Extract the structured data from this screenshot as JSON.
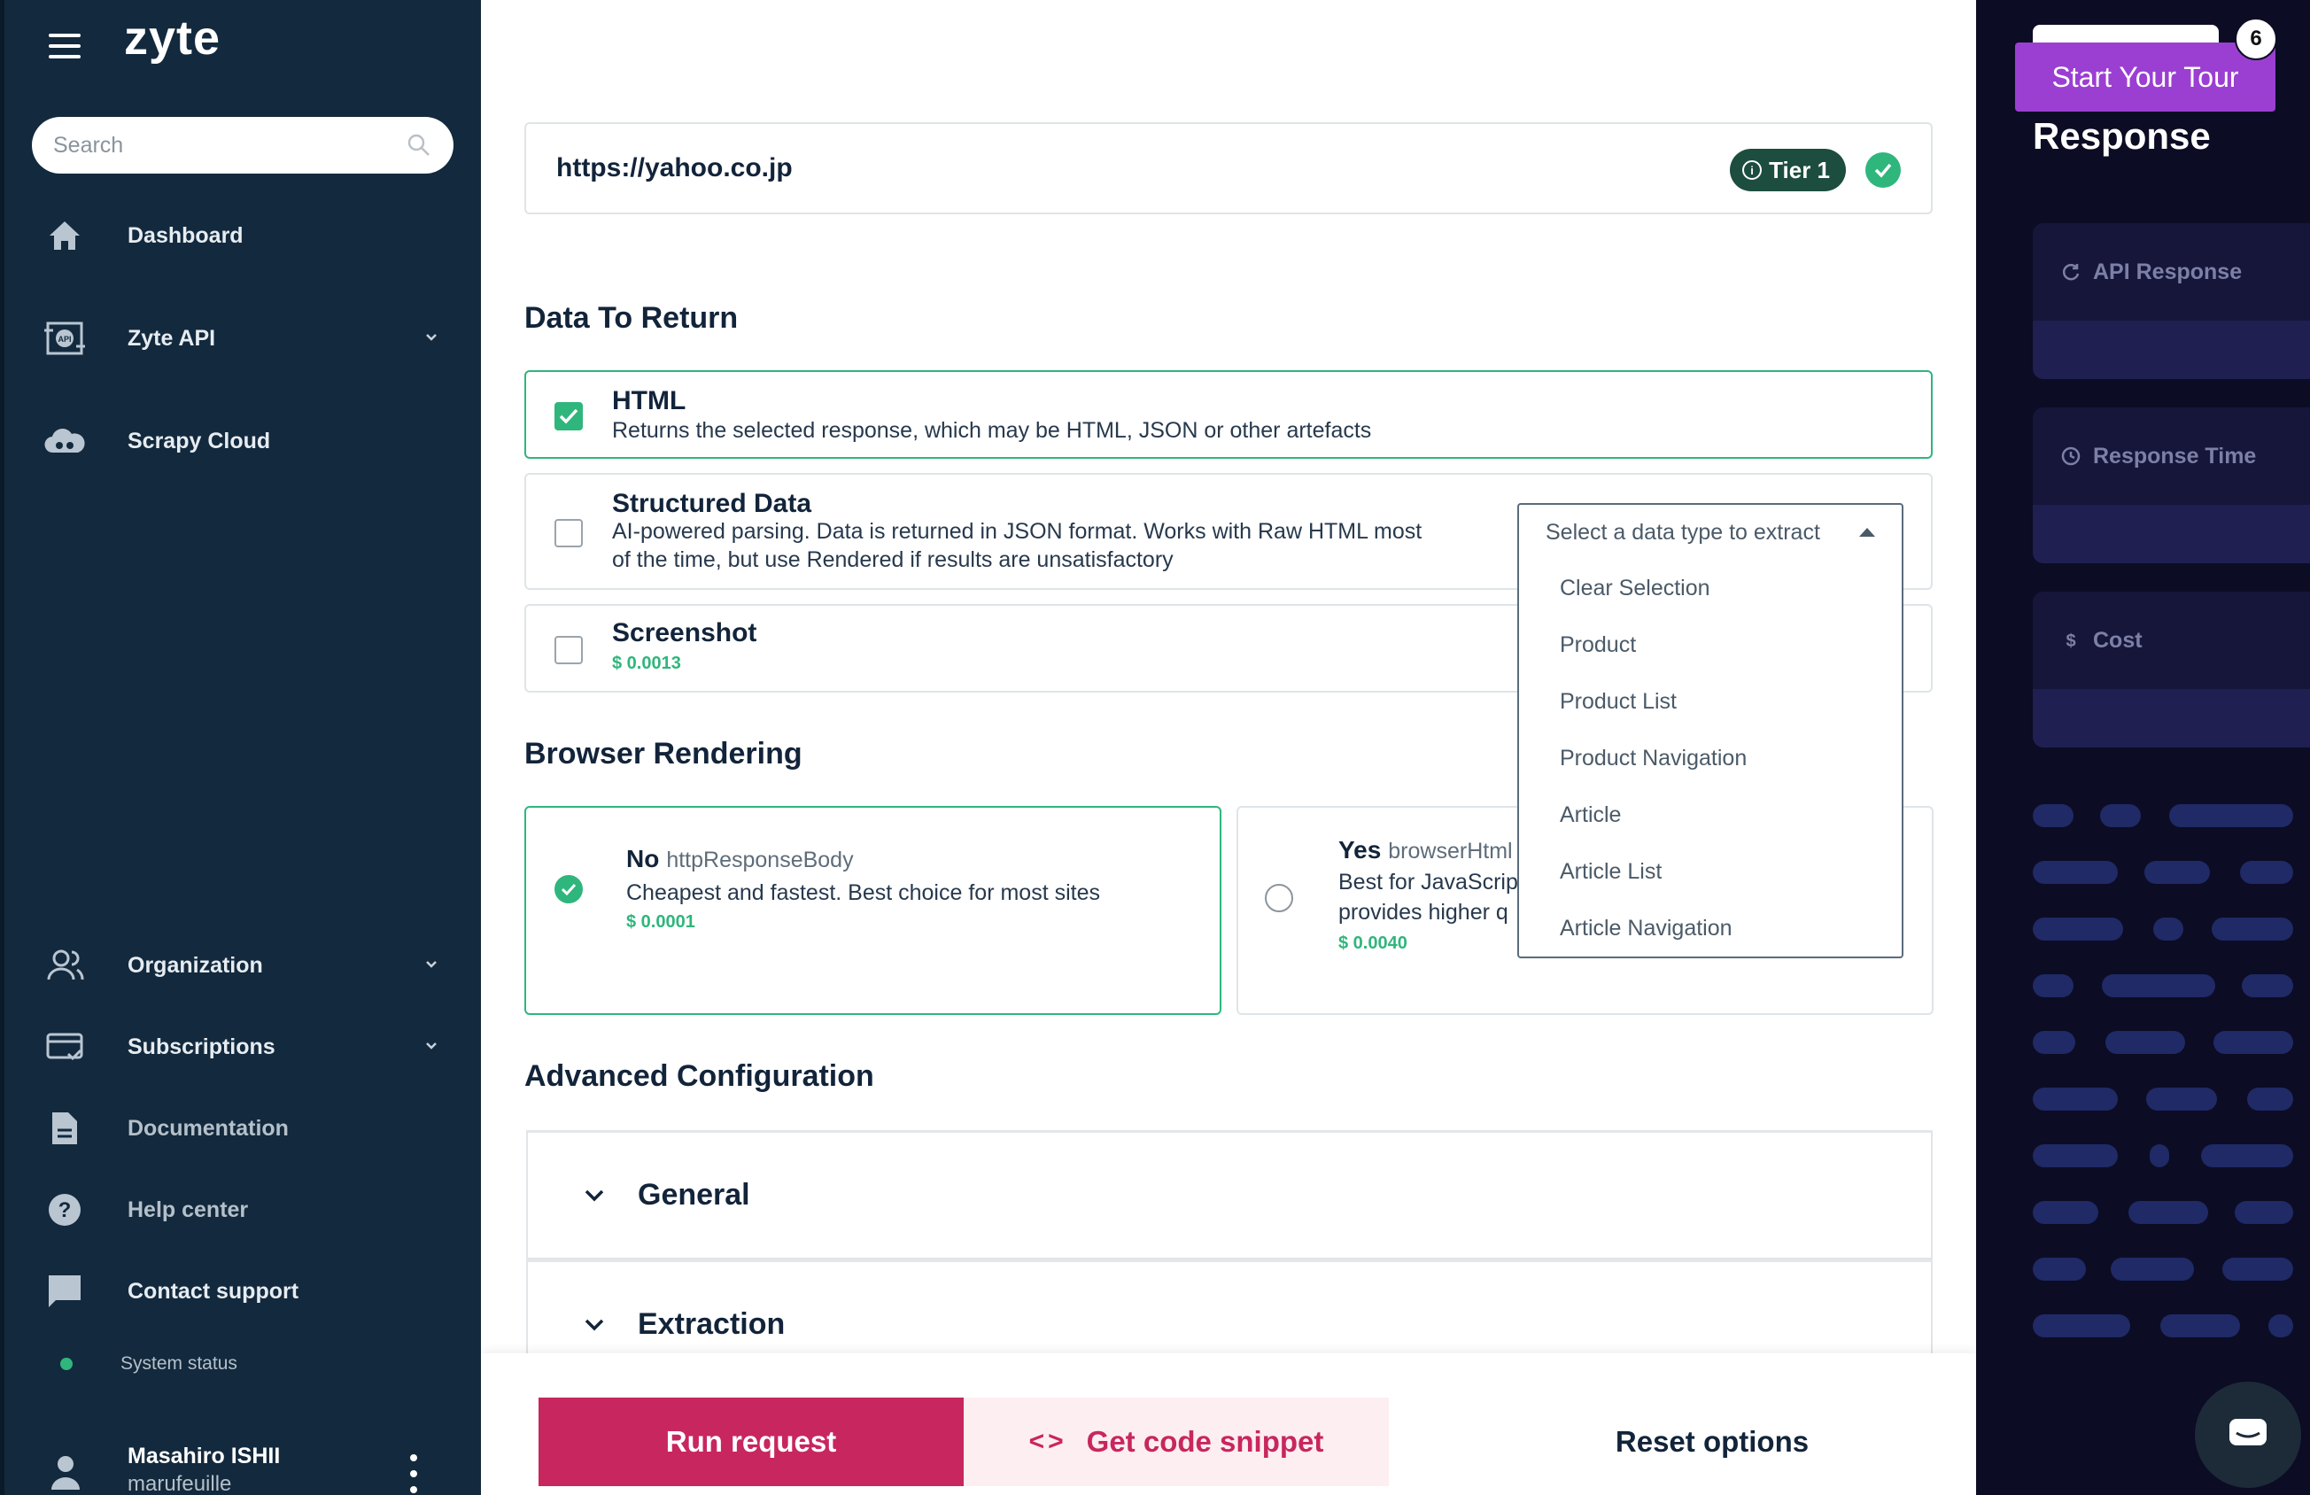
{
  "sidebar": {
    "logo": "zyte",
    "search_placeholder": "Search",
    "nav_top": [
      {
        "label": "Dashboard",
        "icon": "home-icon"
      },
      {
        "label": "Zyte API",
        "icon": "api-icon"
      },
      {
        "label": "Scrapy Cloud",
        "icon": "cloud-icon"
      }
    ],
    "nav_bottom": [
      {
        "label": "Organization",
        "icon": "organization-icon"
      },
      {
        "label": "Subscriptions",
        "icon": "card-icon"
      },
      {
        "label": "Documentation",
        "icon": "document-icon"
      },
      {
        "label": "Help center",
        "icon": "help-icon"
      },
      {
        "label": "Contact support",
        "icon": "chat-bubble-icon"
      }
    ],
    "system_status": "System status",
    "user": {
      "name": "Masahiro ISHII",
      "org": "marufeuille"
    }
  },
  "main": {
    "url": "https://yahoo.co.jp",
    "tier_badge": "Tier 1",
    "data_to_return": {
      "title": "Data To Return",
      "options": [
        {
          "title": "HTML",
          "desc": "Returns the selected response, which may be HTML, JSON or other artefacts",
          "checked": true
        },
        {
          "title": "Structured Data",
          "desc_line1": "AI-powered parsing. Data is returned in JSON format. Works with Raw HTML most",
          "desc_line2": "of the time, but use Rendered if results are unsatisfactory",
          "checked": false
        },
        {
          "title": "Screenshot",
          "price": "$ 0.0013",
          "checked": false
        }
      ],
      "select": {
        "placeholder": "Select a data type to extract",
        "options": [
          "Clear Selection",
          "Product",
          "Product List",
          "Product Navigation",
          "Article",
          "Article List",
          "Article Navigation"
        ]
      }
    },
    "browser_rendering": {
      "title": "Browser Rendering",
      "no": {
        "title": "No",
        "sub": "httpResponseBody",
        "desc": "Cheapest and fastest. Best choice for most sites",
        "price": "$ 0.0001",
        "selected": true
      },
      "yes": {
        "title": "Yes",
        "sub": "browserHtml",
        "desc_line1": "Best for JavaScript",
        "desc_line2": "provides higher q",
        "price": "$ 0.0040",
        "selected": false
      }
    },
    "advanced": {
      "title": "Advanced Configuration",
      "sections": [
        "General",
        "Extraction"
      ]
    },
    "buttons": {
      "run": "Run request",
      "snippet": "Get code snippet",
      "reset": "Reset options"
    }
  },
  "right_panel": {
    "title": "Response",
    "tour_button": "Start Your Tour",
    "tour_count": "6",
    "metrics": [
      {
        "label": "API Response",
        "icon": "refresh-icon"
      },
      {
        "label": "Response Time",
        "icon": "clock-icon"
      },
      {
        "label": "Cost",
        "icon": "dollar-icon"
      }
    ]
  },
  "colors": {
    "sidebar": "#13293d",
    "accent_green": "#2fb67c",
    "run_button": "#c8265e",
    "right_panel": "#0c0c24",
    "tour": "#9b3fd2"
  }
}
